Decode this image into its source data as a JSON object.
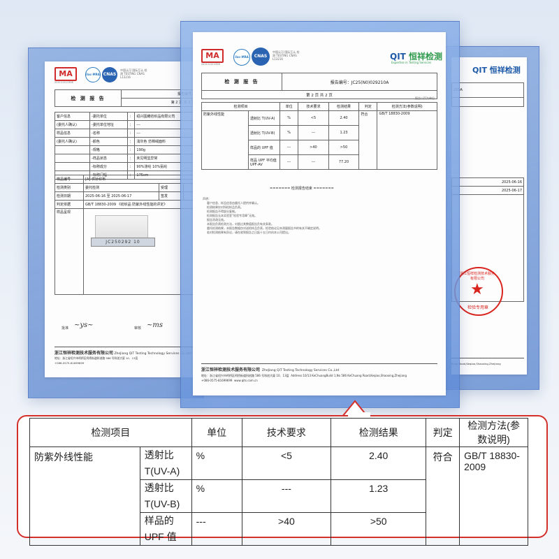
{
  "cma": {
    "mark": "MA",
    "number": "221111111326"
  },
  "logos": {
    "ilac": "ilac-MRA",
    "cnas": "CNAS",
    "cnas_sub": "中国认可 国际互认 检测 TESTING CNAS L13216"
  },
  "brand": {
    "name": "QIT",
    "cn": "恒祥检测",
    "slogan": "Expertise in Testing Services"
  },
  "report": {
    "title": "检 测 报 告",
    "number_label": "报告编号：",
    "number_value": "JC25(N0)029210A",
    "page_info": "第 2 页 共 2 页",
    "note_right": "报告以页为单位",
    "end_marker": "======= 检测报告结束 ======="
  },
  "left_report": {
    "rows": [
      [
        "客户信息",
        "-委托单位",
        "：",
        "绍兴瓯耀纺织品有限公司"
      ],
      [
        "(委托人确认)",
        "-委托单位地址",
        "：",
        "---"
      ],
      [
        "样品信息",
        "-名称",
        "：",
        "---"
      ],
      [
        "(委托人确认)",
        "-颜色",
        "：",
        "浅灰色 仿棉绒面料"
      ],
      [
        "",
        "-规格",
        "：",
        "190g"
      ],
      [
        "",
        "-样品状态",
        "：",
        "未见明显异常"
      ],
      [
        "",
        "-标称成分",
        "：",
        "90%涤纶 10%氨纶"
      ],
      [
        "",
        "-标称门幅",
        "：",
        "175cm"
      ]
    ],
    "sample_id": "[A]-供针织布",
    "sample_label": "样品编号",
    "test_type_label": "检测类别",
    "test_type": "委托检测",
    "accept_label": "受理",
    "date_label": "检测日期",
    "date_value": "2025-06-16 至 2025-06-17",
    "sign_label": "签发",
    "judge_label": "判定依据",
    "judge_value": "GB/T 18830-2009 《纺织品 防紫外线性能的评定》",
    "photo_label": "样品呈现",
    "photo_tag": "JC250292 10",
    "approve": "批准",
    "review": "审核"
  },
  "right_report": {
    "no_suffix": "210A",
    "date1": "2025-06-16",
    "date2": "2025-06-17",
    "seal_text": "浙江恒祥检测技术服务有限公司",
    "seal_bottom": "检验专用章",
    "addr_tail": "Kuan Road,Keqiao,Shaoxing,Zhejiang"
  },
  "company": {
    "name_cn": "浙江恒祥检测技术服务有限公司",
    "name_en": "ZheJiang QiT Testing Technology Services Co.,Ltd",
    "addr_cn": "地址：浙江省绍兴市柯桥区柯桥街道科创路 586 号科创大厦 10、13层",
    "addr_en": "Address:10/13 KeChuangBuild 1,No 586 KeChuang Road,Keqiao,Shaoxing,Zhejiang",
    "tel": "+086-0575-81699699",
    "web": "www.qits.com.cn"
  },
  "center_table": {
    "headers": [
      "检测项目",
      "单位",
      "技术要求",
      "检测结果",
      "判定",
      "检测方法(参数说明)"
    ],
    "item": "防紫外线性能",
    "rows": [
      {
        "param": "透射比 T(UV-A)",
        "unit": "%",
        "req": "<5",
        "result": "2.40"
      },
      {
        "param": "透射比 T(UV-B)",
        "unit": "%",
        "req": "---",
        "result": "1.23"
      },
      {
        "param": "样品的 UPF 值",
        "unit": "---",
        "req": ">40",
        "result": ">50"
      },
      {
        "param": "样品 UPF 平均值 UPF-AV",
        "unit": "---",
        "req": "---",
        "result": "77.20"
      }
    ],
    "verdict": "符合",
    "method": "GB/T 18830-2009",
    "notes": [
      "声明：",
      "客户信息、样品信息由委托人提供并确认。",
      "检测结果仅对所检样品负责。",
      "检测报告不得部分复制。",
      "检测报告无本实验室“检验专用章”无效。",
      "报告涂改无效。",
      "本报告负责检测方法，对超过其数值报告负有关条款。",
      "委托检测结果，本报告数据仅对送检样品负责，检验结论见本测量报告书的有关不确定说明。",
      "若对检测结果有异议，请在收到报告之日起十五日内向本公司提出。"
    ]
  },
  "zoom": {
    "headers": [
      "检测项目",
      "单位",
      "技术要求",
      "检测结果",
      "判定",
      "检测方法(参数说明)"
    ],
    "item": "防紫外线性能",
    "rows": [
      {
        "p1": "透射比",
        "p2": "T(UV-A)",
        "unit": "%",
        "req": "<5",
        "result": "2.40"
      },
      {
        "p1": "透射比",
        "p2": "T(UV-B)",
        "unit": "%",
        "req": "---",
        "result": "1.23"
      },
      {
        "p1": "样品的",
        "p2": "UPF 值",
        "unit": "---",
        "req": ">40",
        "result": ">50"
      }
    ],
    "verdict": "符合",
    "method": "GB/T 18830-2009"
  },
  "colors": {
    "frame": "#7fa3dc",
    "callout_border": "#d4302b",
    "seal": "#d9231d",
    "brand_green": "#2f9a4d",
    "brand_blue": "#1e5aa8"
  }
}
